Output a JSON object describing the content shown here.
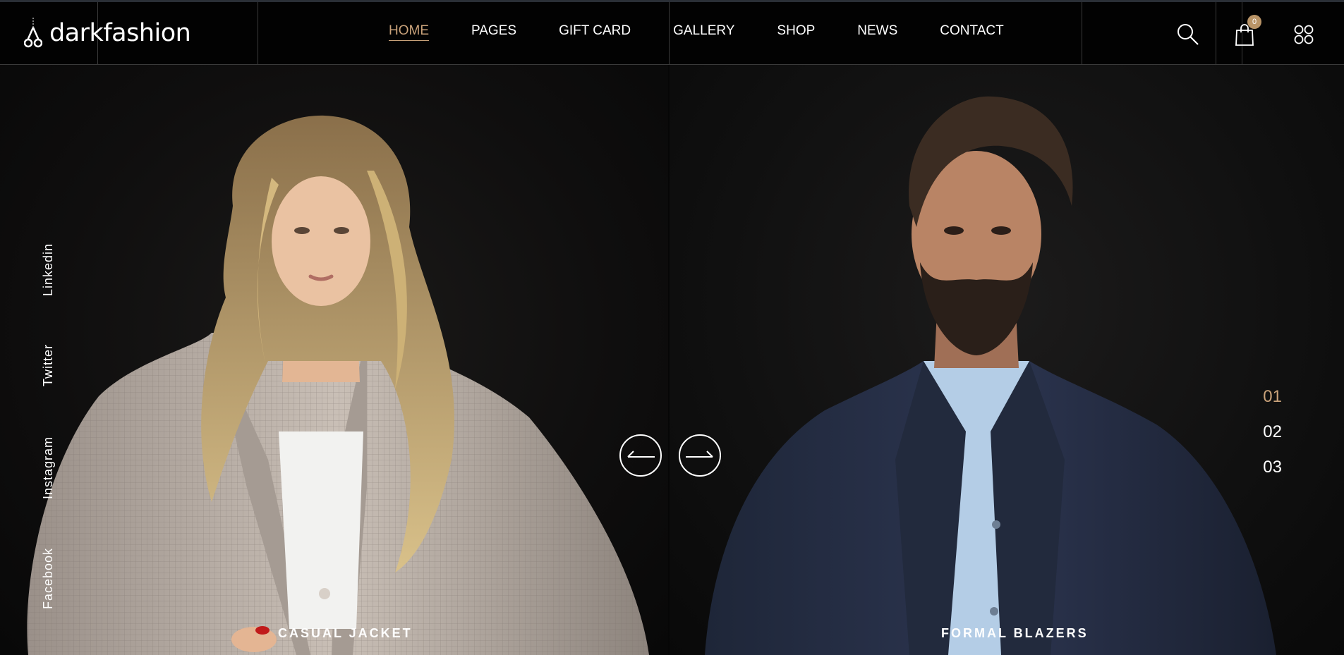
{
  "brand": {
    "name": "darkfashion"
  },
  "nav": {
    "items": [
      {
        "label": "HOME",
        "active": true
      },
      {
        "label": "PAGES"
      },
      {
        "label": "GIFT CARD"
      },
      {
        "label": "GALLERY"
      },
      {
        "label": "SHOP"
      },
      {
        "label": "NEWS"
      },
      {
        "label": "CONTACT"
      }
    ]
  },
  "header_icons": {
    "search": "search-icon",
    "cart": "shopping-bag-icon",
    "cart_count": "0",
    "menu": "grid-menu-icon"
  },
  "hero": {
    "left_caption": "CASUAL JACKET",
    "right_caption": "FORMAL BLAZERS",
    "social": [
      "Linkedin",
      "Twitter",
      "Instagram",
      "Facebook"
    ],
    "slides": [
      "01",
      "02",
      "03"
    ],
    "active_slide": "01"
  },
  "colors": {
    "accent": "#c9a27a",
    "badge": "#b99467",
    "background": "#0b0b0b"
  }
}
